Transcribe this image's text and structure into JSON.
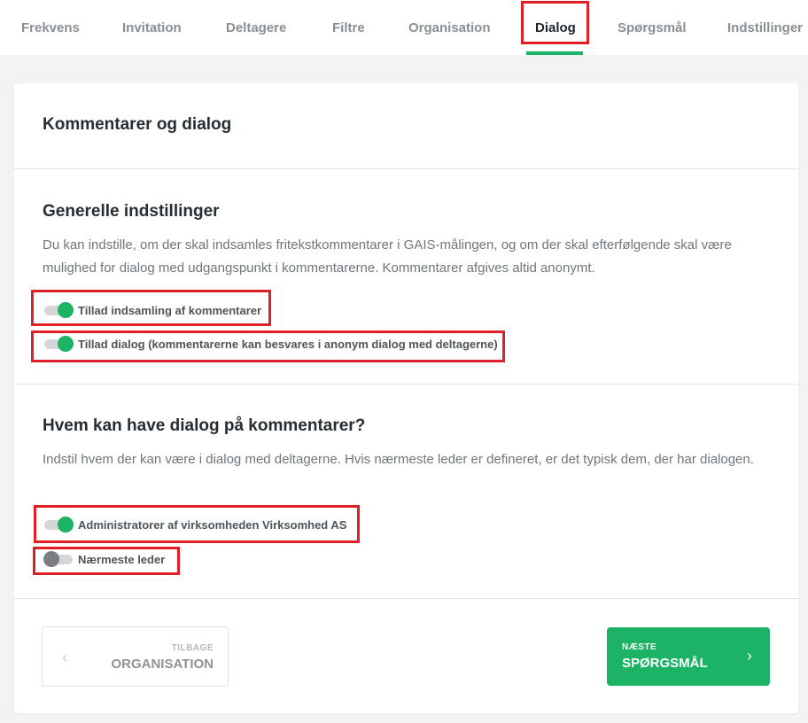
{
  "nav": {
    "tabs": [
      {
        "label": "Frekvens"
      },
      {
        "label": "Invitation"
      },
      {
        "label": "Deltagere"
      },
      {
        "label": "Filtre"
      },
      {
        "label": "Organisation"
      },
      {
        "label": "Dialog",
        "active": true
      },
      {
        "label": "Spørgsmål"
      },
      {
        "label": "Indstillinger"
      }
    ]
  },
  "card": {
    "title": "Kommentarer og dialog"
  },
  "general": {
    "title": "Generelle indstillinger",
    "description": "Du kan indstille, om der skal indsamles fritekstkommentarer i GAIS-målingen, og om der skal efterfølgende skal være mulighed for dialog med udgangspunkt i kommentarerne. Kommentarer afgives altid anonymt.",
    "toggles": [
      {
        "label": "Tillad indsamling af kommentarer",
        "on": true
      },
      {
        "label": "Tillad dialog (kommentarerne kan besvares i anonym dialog med deltagerne)",
        "on": true
      }
    ]
  },
  "who": {
    "title": "Hvem kan have dialog på kommentarer?",
    "description": "Indstil hvem der kan være i dialog med deltagerne. Hvis nærmeste leder er defineret, er det typisk dem, der har dialogen.",
    "toggles": [
      {
        "label": "Administratorer af virksomheden Virksomhed AS",
        "on": true
      },
      {
        "label": "Nærmeste leder",
        "on": false
      }
    ]
  },
  "footer": {
    "back": {
      "small": "TILBAGE",
      "big": "ORGANISATION",
      "icon": "chevron-left-icon"
    },
    "next": {
      "small": "NÆSTE",
      "big": "SPØRGSMÅL",
      "icon": "chevron-right-icon"
    }
  },
  "colors": {
    "accent": "#1db364",
    "highlight": "#e01f26"
  }
}
